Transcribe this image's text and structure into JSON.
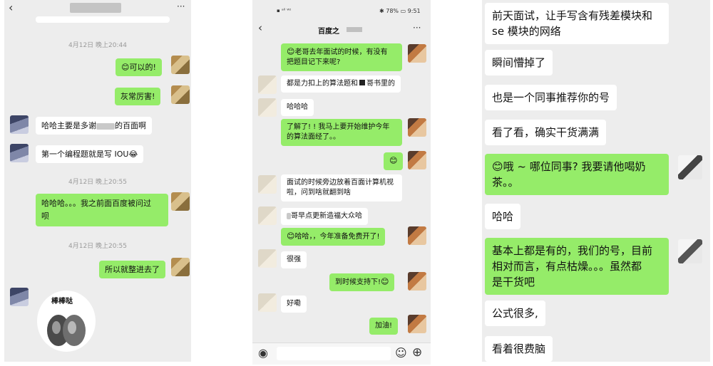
{
  "panel1": {
    "header": {
      "back": "‹",
      "more": "···"
    },
    "times": [
      "4月12日 晚上20:44",
      "4月12日 晚上20:55",
      "4月12日 晚上20:55"
    ],
    "messages": [
      "可以的!",
      "灰常厉害!",
      "哈哈主要是多谢",
      "的百面啊",
      "第一个编程题就是写 IOU",
      "哈哈哈。。。我之前面百度被问过",
      "呗",
      "所以就整进去了"
    ],
    "sticker_text": "棒棒哒"
  },
  "panel2": {
    "status": {
      "left": "▪ ᵃˡˡ ᵂᶦ",
      "right": "✱ 78% ▭ 9:51"
    },
    "title": "百度之",
    "messages": [
      "老哥去年面试的时候，有没有",
      "把题目记下来呢?",
      "都是力扣上的算法题和",
      "哥书里的",
      "哈哈哈",
      "了解了! ! 我马上要开始维护今年",
      "的算法面经了。。",
      "面试的时候旁边放着百面计算机视",
      "啦，问到啥就翻到啥",
      "哥早点更新造福大众哈",
      "哈哈，，今年准备免费开了!",
      "很强",
      "到时候支持下!",
      "好嘞",
      "加油!"
    ]
  },
  "panel3": {
    "messages": [
      "前天面试，让手写含有残差模块和",
      "se 模块的网络",
      "瞬间懵掉了",
      "也是一个同事推荐你的号",
      "看了看，确实干货满满",
      "哦 ~ 哪位同事? 我要请他喝奶",
      "茶。。",
      "哈哈",
      "基本上都是有的，我们的号，目前",
      "相对而言，有点枯燥。。。虽然都",
      "是干货吧",
      "公式很多,",
      "看着很费脑"
    ]
  },
  "icons": {
    "emoji_face": "☺",
    "voice": "◉",
    "plus": "⊕",
    "chevron_left": "‹"
  }
}
